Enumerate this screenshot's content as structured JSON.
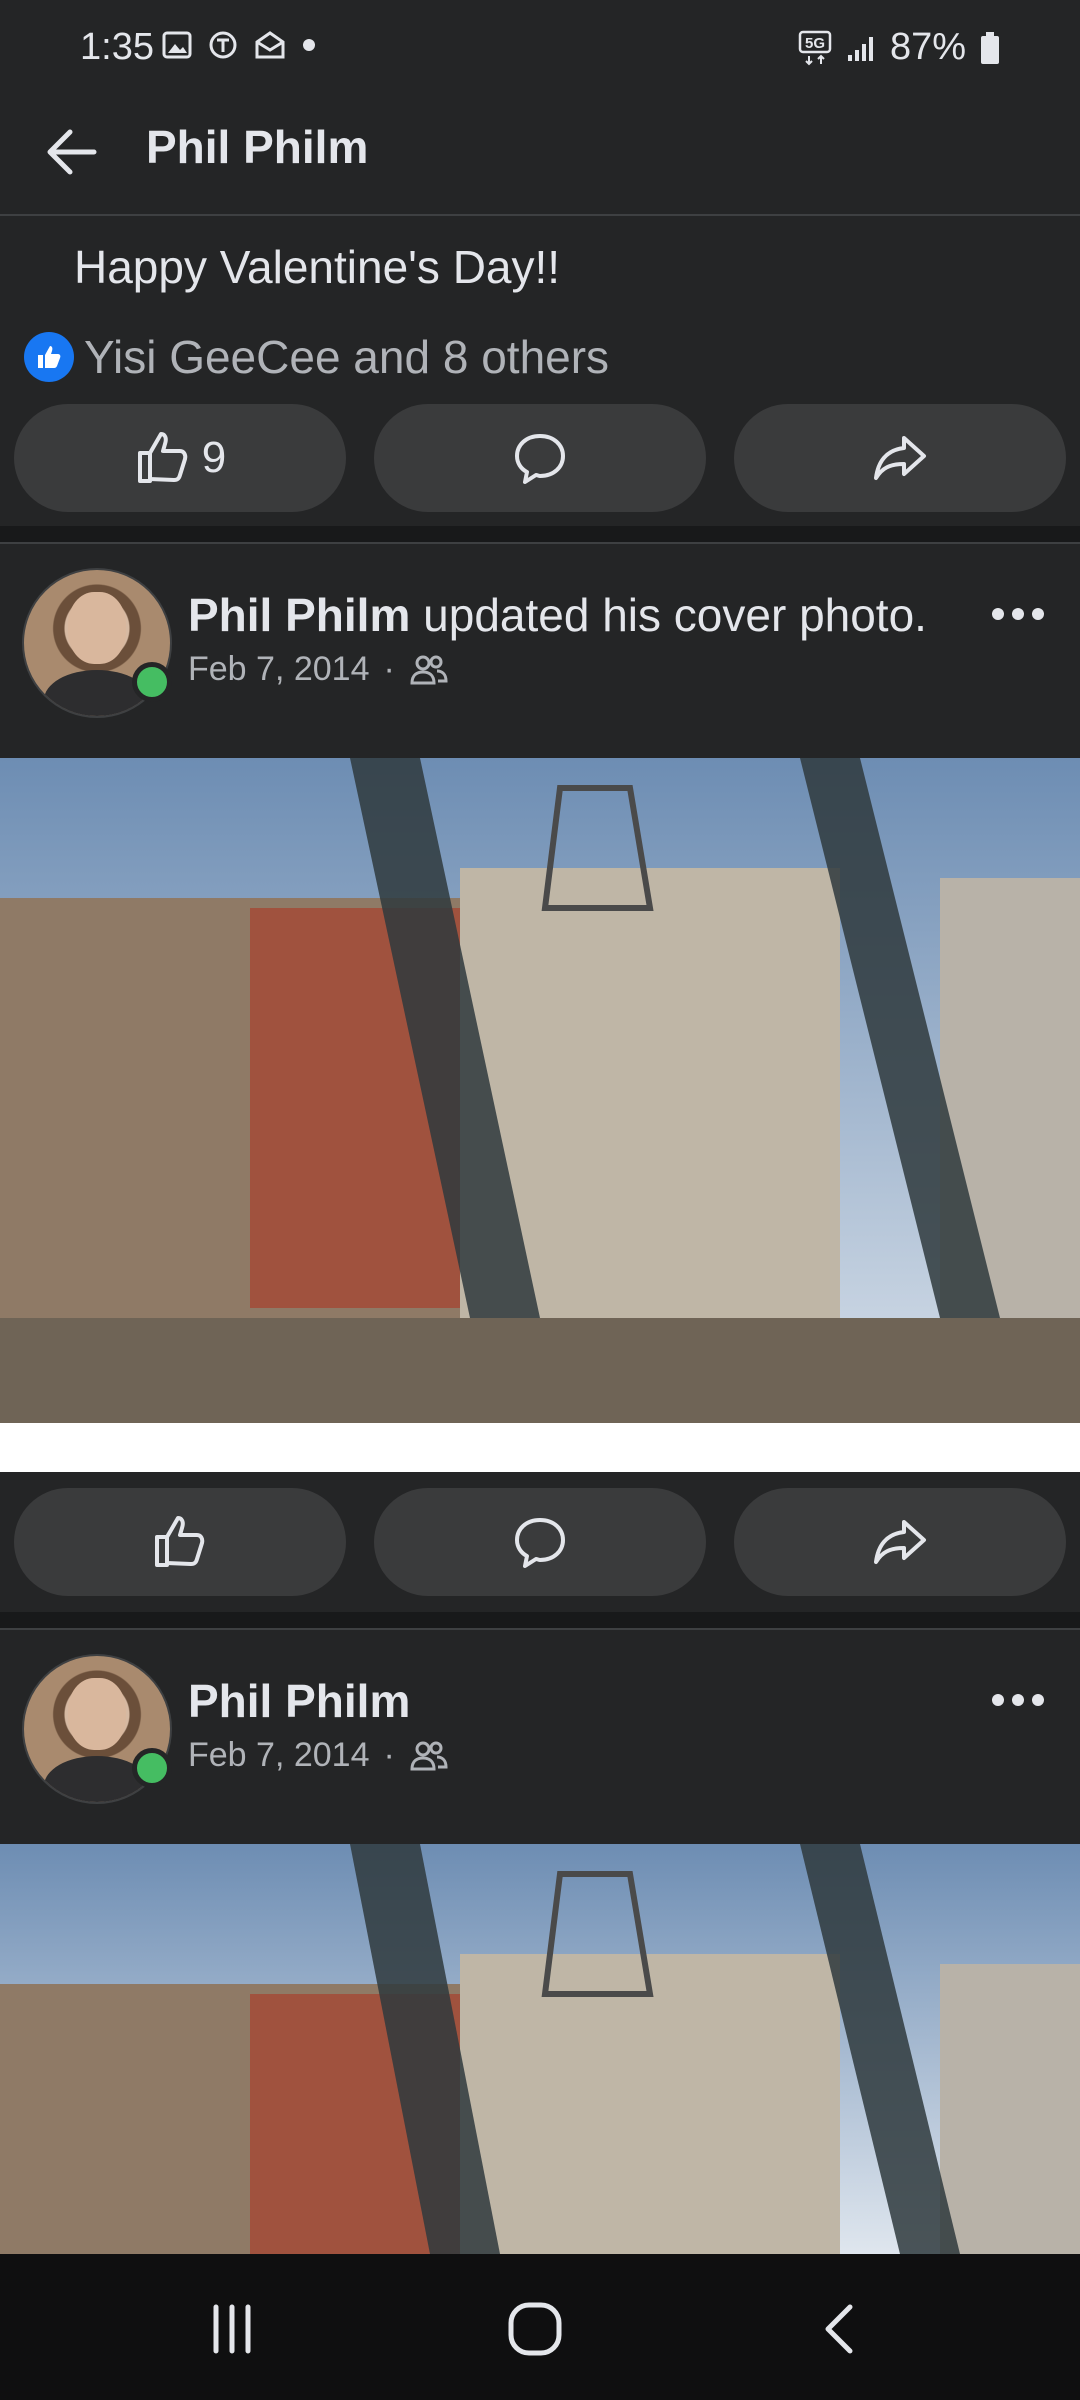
{
  "status_bar": {
    "time": "1:35",
    "network": "5G",
    "battery": "87%"
  },
  "header": {
    "title": "Phil Philm"
  },
  "post1": {
    "text": "Happy Valentine's Day!!",
    "reactions_text": "Yisi GeeCee and 8 others",
    "like_count": "9"
  },
  "post2": {
    "author": "Phil Philm",
    "action_text": "updated his cover photo.",
    "date": "Feb 7, 2014",
    "separator": "·"
  },
  "post3": {
    "author": "Phil Philm",
    "date": "Feb 7, 2014",
    "separator": "·"
  },
  "colors": {
    "background": "#242526",
    "button": "#3a3b3c",
    "like_blue": "#1877f2",
    "online_green": "#45bd62"
  }
}
